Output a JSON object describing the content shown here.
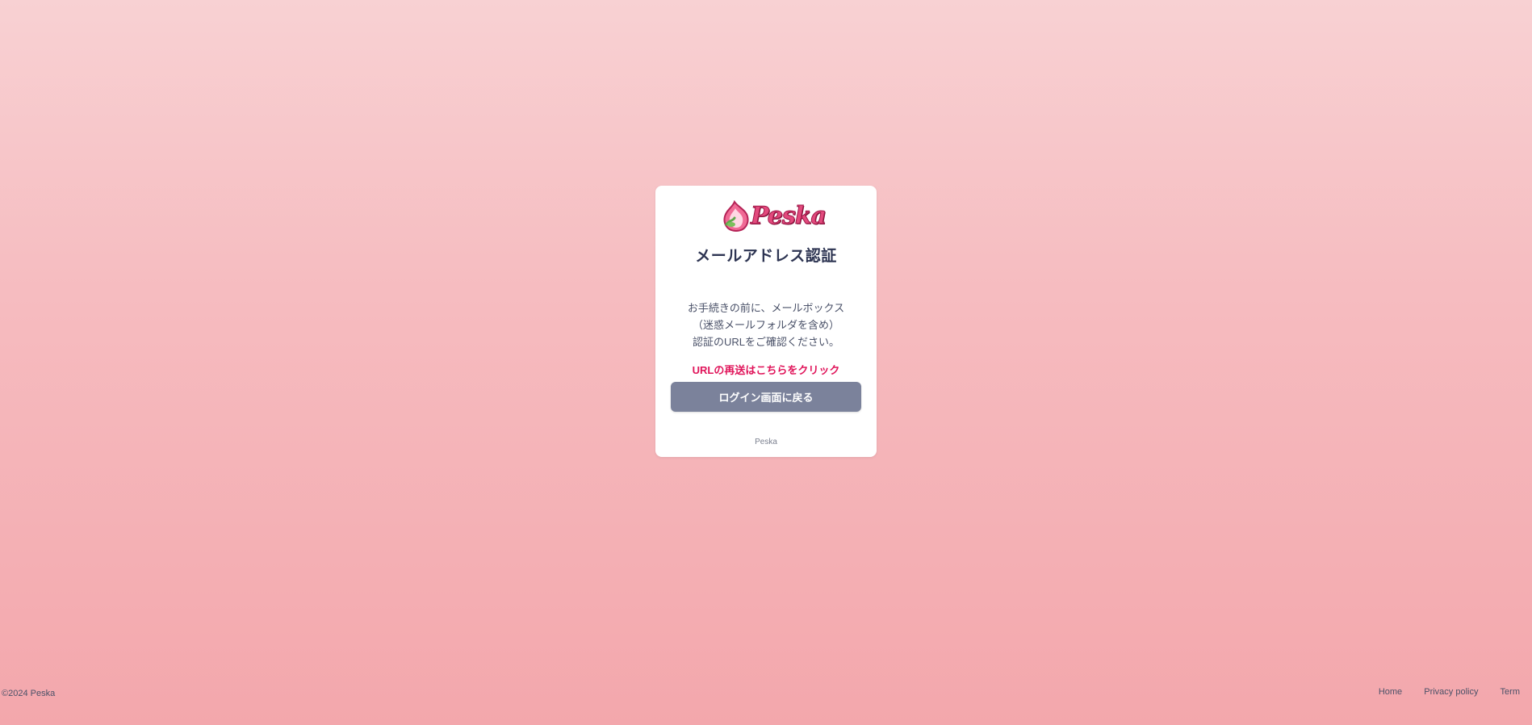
{
  "app": {
    "brand_name": "Peska",
    "accent_color": "#e0145a",
    "button_color": "#7b829b"
  },
  "card": {
    "logo_icon": "peach-icon",
    "title": "メールアドレス認証",
    "message_lines": [
      "お手続きの前に、メールボックス",
      "（迷惑メールフォルダを含め）",
      "認証のURLをご確認ください。"
    ],
    "resend_link_label": "URLの再送はこちらをクリック",
    "back_button_label": "ログイン画面に戻る",
    "footer_text": "Peska"
  },
  "footer": {
    "copyright": "©2024 Peska",
    "links": [
      {
        "label": "Home"
      },
      {
        "label": "Privacy policy"
      },
      {
        "label": "Term"
      }
    ]
  }
}
